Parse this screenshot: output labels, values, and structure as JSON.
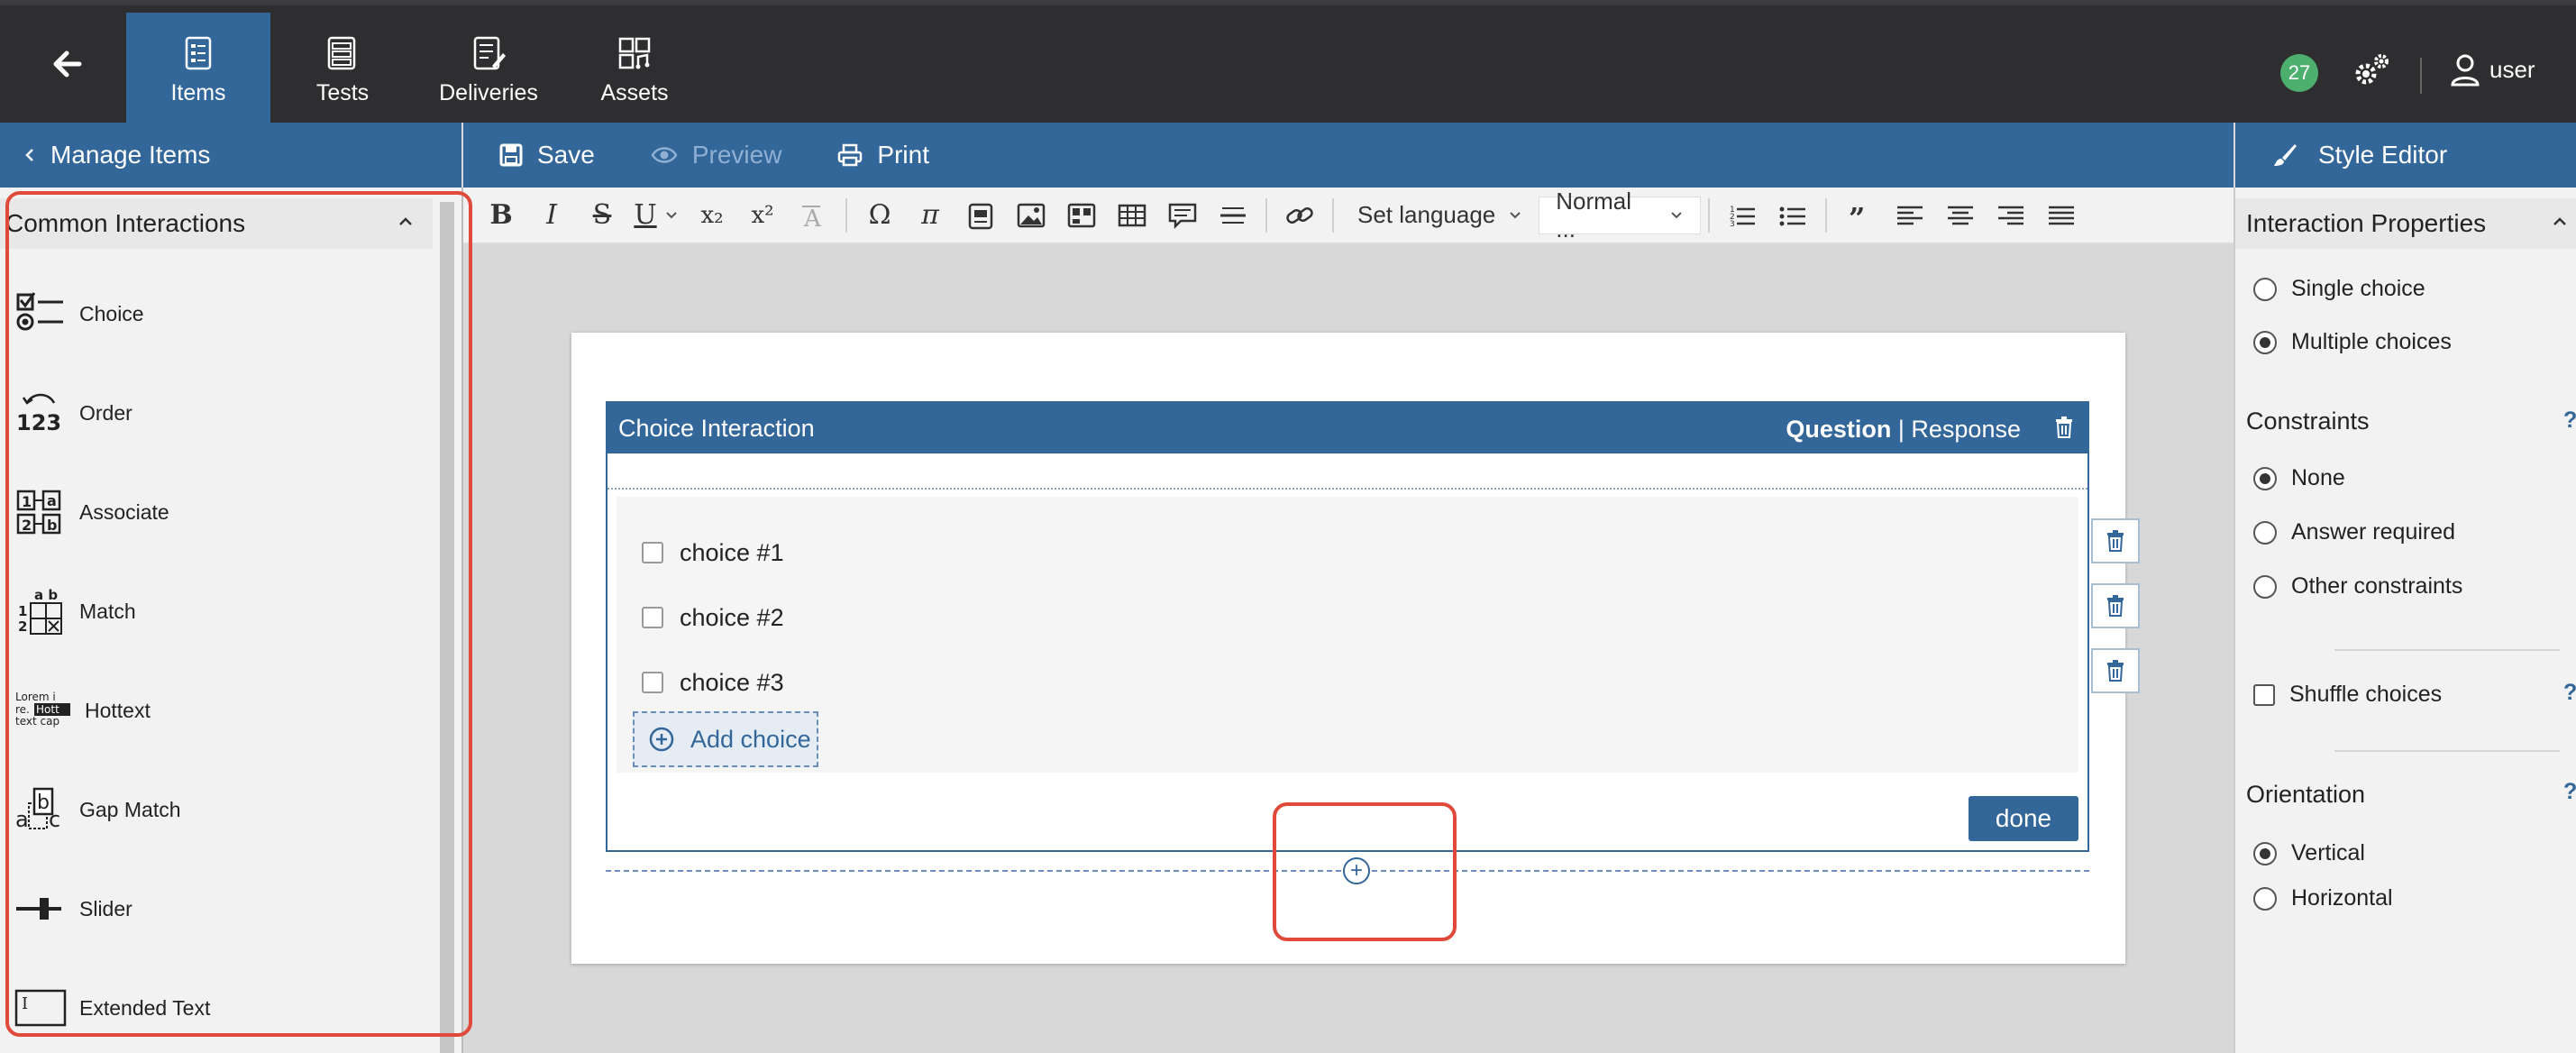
{
  "topbar": {
    "tabs": [
      {
        "label": "Items",
        "icon": "items-icon",
        "active": true
      },
      {
        "label": "Tests",
        "icon": "tests-icon",
        "active": false
      },
      {
        "label": "Deliveries",
        "icon": "deliveries-icon",
        "active": false
      },
      {
        "label": "Assets",
        "icon": "assets-icon",
        "active": false
      }
    ],
    "notification_count": "27",
    "user_label": "user"
  },
  "subbar": {
    "manage_items": "Manage Items",
    "save": "Save",
    "preview": "Preview",
    "print": "Print",
    "style_editor": "Style Editor"
  },
  "left_panel": {
    "title": "Common Interactions",
    "items": [
      {
        "label": "Choice",
        "icon": "choice-icon"
      },
      {
        "label": "Order",
        "icon": "order-icon"
      },
      {
        "label": "Associate",
        "icon": "associate-icon"
      },
      {
        "label": "Match",
        "icon": "match-icon"
      },
      {
        "label": "Hottext",
        "icon": "hottext-icon"
      },
      {
        "label": "Gap Match",
        "icon": "gap-match-icon"
      },
      {
        "label": "Slider",
        "icon": "slider-icon"
      },
      {
        "label": "Extended Text",
        "icon": "extended-text-icon"
      }
    ],
    "icon_text": {
      "order": "123",
      "associate_a": "a",
      "associate_b": "b",
      "associate_1": "1",
      "associate_2": "2",
      "match_header": "a b",
      "match_1": "1",
      "match_2": "2",
      "hottext": [
        "Lorem i",
        "re.",
        "Hott",
        "text cap"
      ],
      "gap_a": "a",
      "gap_b": "b",
      "gap_c": "c",
      "extended": "I"
    }
  },
  "toolbar": {
    "bold": "B",
    "italic": "I",
    "strike": "S",
    "underline": "U",
    "subscript": "x₂",
    "superscript": "x²",
    "omega": "Ω",
    "pi": "π",
    "set_language": "Set language",
    "format": "Normal ..."
  },
  "editor": {
    "interaction_title": "Choice Interaction",
    "question_label": "Question",
    "separator": "|",
    "response_label": "Response",
    "choices": [
      "choice #1",
      "choice #2",
      "choice #3"
    ],
    "add_choice": "Add choice",
    "done": "done",
    "insert_symbol": "+"
  },
  "right_panel": {
    "title": "Interaction Properties",
    "choice_mode": [
      {
        "label": "Single choice",
        "selected": false
      },
      {
        "label": "Multiple choices",
        "selected": true
      }
    ],
    "constraints_label": "Constraints",
    "constraints": [
      {
        "label": "None",
        "selected": true
      },
      {
        "label": "Answer required",
        "selected": false
      },
      {
        "label": "Other constraints",
        "selected": false
      }
    ],
    "shuffle_label": "Shuffle choices",
    "orientation_label": "Orientation",
    "orientation": [
      {
        "label": "Vertical",
        "selected": true
      },
      {
        "label": "Horizontal",
        "selected": false
      }
    ],
    "help": "?"
  },
  "colors": {
    "brand_blue": "#336699",
    "topbar": "#2e2e30",
    "badge_green": "#4caf6e",
    "highlight_red": "#e04a3a"
  }
}
